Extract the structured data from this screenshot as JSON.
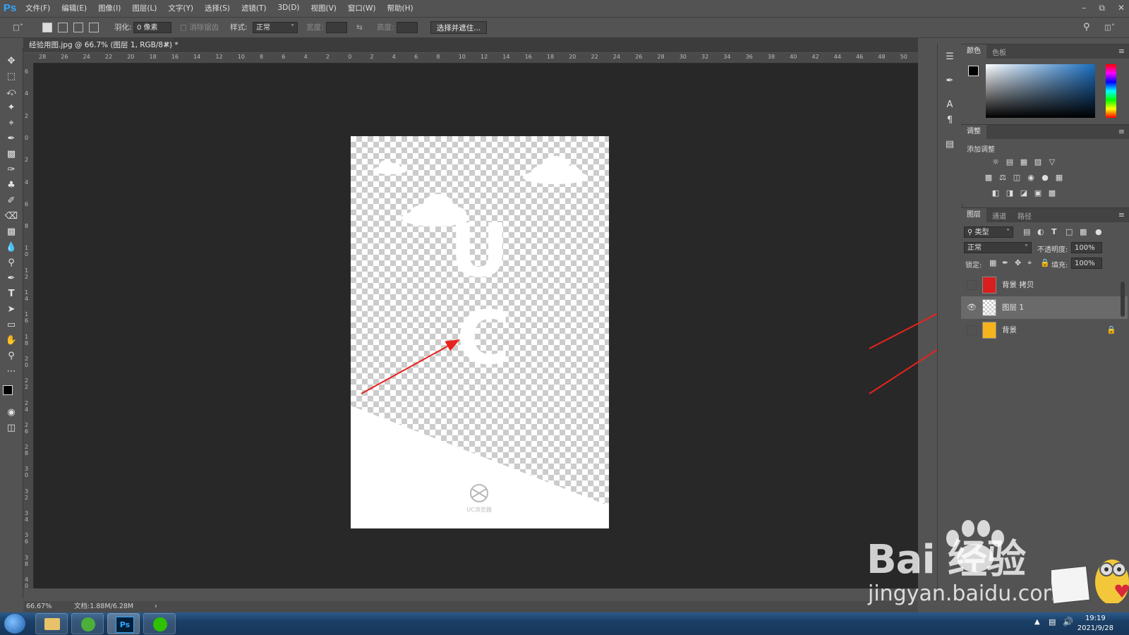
{
  "app": {
    "logo": "Ps"
  },
  "menu": [
    "文件(F)",
    "编辑(E)",
    "图像(I)",
    "图层(L)",
    "文字(Y)",
    "选择(S)",
    "滤镜(T)",
    "3D(D)",
    "视图(V)",
    "窗口(W)",
    "帮助(H)"
  ],
  "options": {
    "feather_label": "羽化:",
    "feather_value": "0 像素",
    "antialias_label": "消除锯齿",
    "style_label": "样式:",
    "style_value": "正常",
    "width_label": "宽度:",
    "height_label": "高度:",
    "select_mask_button": "选择并遮住..."
  },
  "document": {
    "tab_title": "经验用图.jpg @ 66.7% (图层 1, RGB/8#) *",
    "canvas_letters": [
      "U",
      "C"
    ],
    "logo_caption": "UC浏览器"
  },
  "ruler": {
    "top_ticks": [
      "28",
      "26",
      "24",
      "22",
      "20",
      "18",
      "16",
      "14",
      "12",
      "10",
      "8",
      "6",
      "4",
      "2",
      "0",
      "2",
      "4",
      "6",
      "8",
      "10",
      "12",
      "14",
      "16",
      "18",
      "20",
      "22",
      "24",
      "26",
      "28",
      "30",
      "32",
      "34",
      "36",
      "38",
      "40",
      "42",
      "44",
      "46",
      "48",
      "50"
    ],
    "left_ticks": [
      "6",
      "4",
      "2",
      "0",
      "2",
      "4",
      "6",
      "8",
      "1 0",
      "1 2",
      "1 4",
      "1 6",
      "1 8",
      "2 0",
      "2 2",
      "2 4",
      "2 6",
      "2 8",
      "3 0",
      "3 2",
      "3 4",
      "3 6",
      "3 8",
      "4 0"
    ]
  },
  "status": {
    "zoom": "66.67%",
    "doc_size": "文档:1.88M/6.28M"
  },
  "panels": {
    "color": {
      "tabs": [
        "颜色",
        "色板"
      ]
    },
    "adjustments": {
      "tab": "调整",
      "add_label": "添加调整"
    },
    "layers": {
      "tabs": [
        "图层",
        "通道",
        "路径"
      ],
      "filter_kind": "类型",
      "blend_mode": "正常",
      "opacity_label": "不透明度:",
      "opacity_value": "100%",
      "lock_label": "锁定:",
      "fill_label": "填充:",
      "fill_value": "100%",
      "items": [
        {
          "name": "背景 拷贝",
          "visible": false,
          "selected": false
        },
        {
          "name": "图层 1",
          "visible": true,
          "selected": true
        },
        {
          "name": "背景",
          "visible": false,
          "selected": false,
          "locked": true
        }
      ]
    }
  },
  "taskbar": {
    "time": "19:19",
    "date": "2021/9/28",
    "ps_label": "Ps"
  },
  "watermark": {
    "brand": "Bai  经验",
    "url": "jingyan.baidu.com"
  },
  "colors": {
    "arrow": "#e8231e",
    "accent_ps": "#31a8ff"
  }
}
